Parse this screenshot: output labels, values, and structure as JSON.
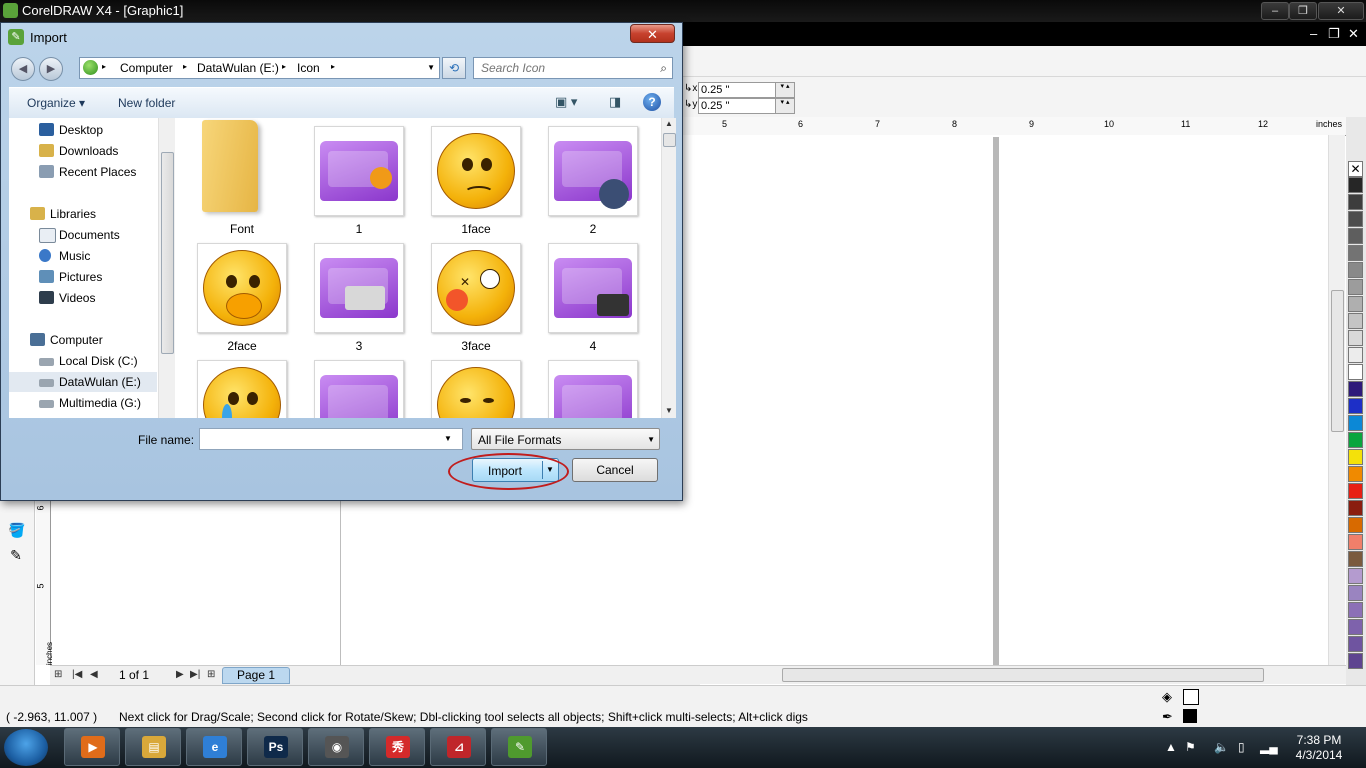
{
  "app": {
    "title": "CorelDRAW X4 - [Graphic1]",
    "window_controls": [
      "–",
      "❐",
      "✕"
    ],
    "mdi_controls": [
      "–",
      "❐",
      "✕"
    ]
  },
  "propbar": {
    "dup_x": "0.25 \"",
    "dup_y": "0.25 \""
  },
  "ruler": {
    "h_ticks": [
      "5",
      "6",
      "7",
      "8",
      "9",
      "10",
      "11",
      "12"
    ],
    "unit": "inches",
    "v_ticks": [
      "6",
      "5"
    ],
    "v_unit": "inches"
  },
  "palette": {
    "colors": [
      "#ffffff",
      "#262626",
      "#3d3d3d",
      "#4d4d4d",
      "#5e5e5e",
      "#737373",
      "#898989",
      "#9c9c9c",
      "#afafaf",
      "#c4c4c4",
      "#d9d9d9",
      "#ececec",
      "#ffffff",
      "#2e1a7a",
      "#1d2fc7",
      "#0c88d6",
      "#0aa53e",
      "#f4e10a",
      "#f08a00",
      "#e71f14",
      "#8a1d0f",
      "#d86a00",
      "#f07f6a",
      "#7a5a3e",
      "#b49bcf",
      "#9a84c0",
      "#8c70b6",
      "#7e62ac",
      "#6f54a0",
      "#5e4490"
    ]
  },
  "pagebar": {
    "page_count": "1 of 1",
    "page_tab": "Page 1"
  },
  "status": {
    "coords": "( -2.963, 11.007 )",
    "message": "Next click for Drag/Scale; Second click for Rotate/Skew; Dbl-clicking tool selects all objects; Shift+click multi-selects; Alt+click digs"
  },
  "taskbar": {
    "apps": [
      {
        "name": "media-player",
        "glyph": "▶",
        "color": "#e06c1a"
      },
      {
        "name": "explorer",
        "glyph": "▤",
        "color": "#d9a83a"
      },
      {
        "name": "internet-explorer",
        "glyph": "e",
        "color": "#2f7fd6"
      },
      {
        "name": "photoshop",
        "glyph": "Ps",
        "color": "#0f2a4a"
      },
      {
        "name": "chrome",
        "glyph": "◉",
        "color": "#555555"
      },
      {
        "name": "meitu",
        "glyph": "秀",
        "color": "#d42a2a"
      },
      {
        "name": "acrobat",
        "glyph": "⊿",
        "color": "#c0262a"
      },
      {
        "name": "coreldraw",
        "glyph": "✎",
        "color": "#4f9a2e"
      }
    ],
    "time": "7:38 PM",
    "date": "4/3/2014"
  },
  "dialog": {
    "title": "Import",
    "close": "✕",
    "breadcrumb": [
      "Computer",
      "DataWulan (E:)",
      "Icon"
    ],
    "search_placeholder": "Search Icon",
    "organize": "Organize",
    "new_folder": "New folder",
    "nav": {
      "favorites": [
        "Desktop",
        "Downloads",
        "Recent Places"
      ],
      "libraries_label": "Libraries",
      "libraries": [
        "Documents",
        "Music",
        "Pictures",
        "Videos"
      ],
      "computer_label": "Computer",
      "drives": [
        "Local Disk (C:)",
        "DataWulan (E:)",
        "Multimedia (G:)"
      ],
      "selected": "DataWulan (E:)"
    },
    "files": [
      "Font",
      "1",
      "1face",
      "2",
      "2face",
      "3",
      "3face",
      "4"
    ],
    "file_name_label": "File name:",
    "file_name_value": "",
    "format": "All File Formats",
    "import_label": "Import",
    "cancel_label": "Cancel"
  }
}
